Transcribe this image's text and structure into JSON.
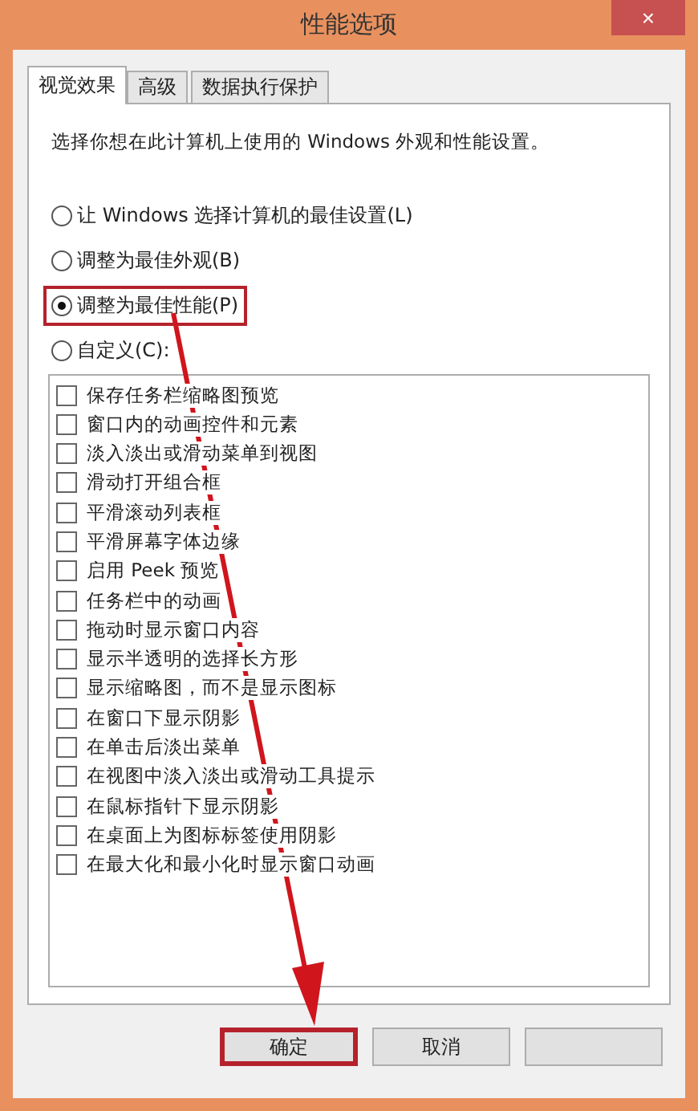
{
  "window": {
    "title": "性能选项",
    "close": "×"
  },
  "tabs": [
    {
      "label": "视觉效果",
      "selected": true
    },
    {
      "label": "高级",
      "selected": false
    },
    {
      "label": "数据执行保护",
      "selected": false
    }
  ],
  "intro": "选择你想在此计算机上使用的 Windows 外观和性能设置。",
  "options": [
    {
      "label": "让 Windows 选择计算机的最佳设置(L)",
      "selected": false,
      "highlighted": false
    },
    {
      "label": "调整为最佳外观(B)",
      "selected": false,
      "highlighted": false
    },
    {
      "label": "调整为最佳性能(P)",
      "selected": true,
      "highlighted": true
    },
    {
      "label": "自定义(C):",
      "selected": false,
      "highlighted": false
    }
  ],
  "effects": [
    {
      "label": "保存任务栏缩略图预览",
      "checked": false
    },
    {
      "label": "窗口内的动画控件和元素",
      "checked": false
    },
    {
      "label": "淡入淡出或滑动菜单到视图",
      "checked": false
    },
    {
      "label": "滑动打开组合框",
      "checked": false
    },
    {
      "label": "平滑滚动列表框",
      "checked": false
    },
    {
      "label": "平滑屏幕字体边缘",
      "checked": false
    },
    {
      "label": "启用 Peek 预览",
      "checked": false
    },
    {
      "label": "任务栏中的动画",
      "checked": false
    },
    {
      "label": "拖动时显示窗口内容",
      "checked": false
    },
    {
      "label": "显示半透明的选择长方形",
      "checked": false
    },
    {
      "label": "显示缩略图，而不是显示图标",
      "checked": false
    },
    {
      "label": "在窗口下显示阴影",
      "checked": false
    },
    {
      "label": "在单击后淡出菜单",
      "checked": false
    },
    {
      "label": "在视图中淡入淡出或滑动工具提示",
      "checked": false
    },
    {
      "label": "在鼠标指针下显示阴影",
      "checked": false
    },
    {
      "label": "在桌面上为图标标签使用阴影",
      "checked": false
    },
    {
      "label": "在最大化和最小化时显示窗口动画",
      "checked": false
    }
  ],
  "buttons": [
    {
      "label": "确定",
      "highlighted": true
    },
    {
      "label": "取消",
      "highlighted": false
    },
    {
      "highlighted": false
    }
  ],
  "annotation": {
    "arrow": true
  }
}
